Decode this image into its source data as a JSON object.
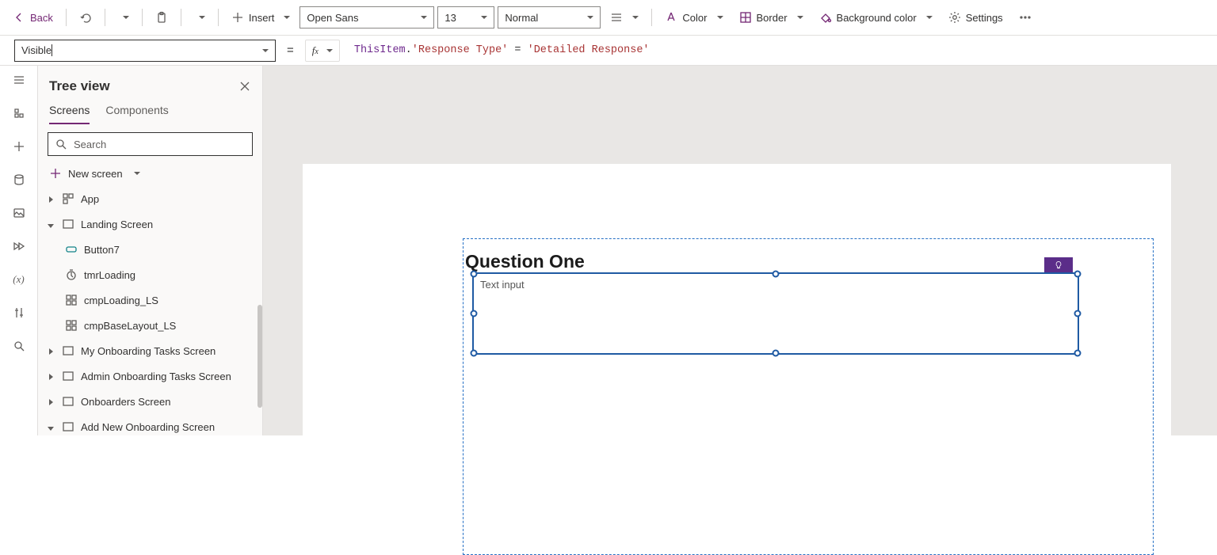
{
  "toolbar": {
    "back": "Back",
    "insert": "Insert",
    "font": "Open Sans",
    "font_size": "13",
    "font_weight": "Normal",
    "color": "Color",
    "border": "Border",
    "bgcolor": "Background color",
    "settings": "Settings"
  },
  "formula_bar": {
    "property": "Visible",
    "formula_obj": "ThisItem",
    "formula_dot": ".",
    "formula_prop": "'Response Type'",
    "formula_assign": " = ",
    "formula_value": "'Detailed Response'"
  },
  "treeview": {
    "title": "Tree view",
    "tabs": {
      "screens": "Screens",
      "components": "Components"
    },
    "search_placeholder": "Search",
    "new_screen": "New screen",
    "nodes": {
      "app": "App",
      "landing": "Landing Screen",
      "button7": "Button7",
      "tmrloading": "tmrLoading",
      "cmploading": "cmpLoading_LS",
      "cmpblayout": "cmpBaseLayout_LS",
      "myonb": "My Onboarding Tasks Screen",
      "adminonb": "Admin Onboarding Tasks Screen",
      "onboarders": "Onboarders Screen",
      "addnew": "Add New Onboarding Screen"
    }
  },
  "canvas": {
    "question": "Question One",
    "input_placeholder": "Text input"
  }
}
